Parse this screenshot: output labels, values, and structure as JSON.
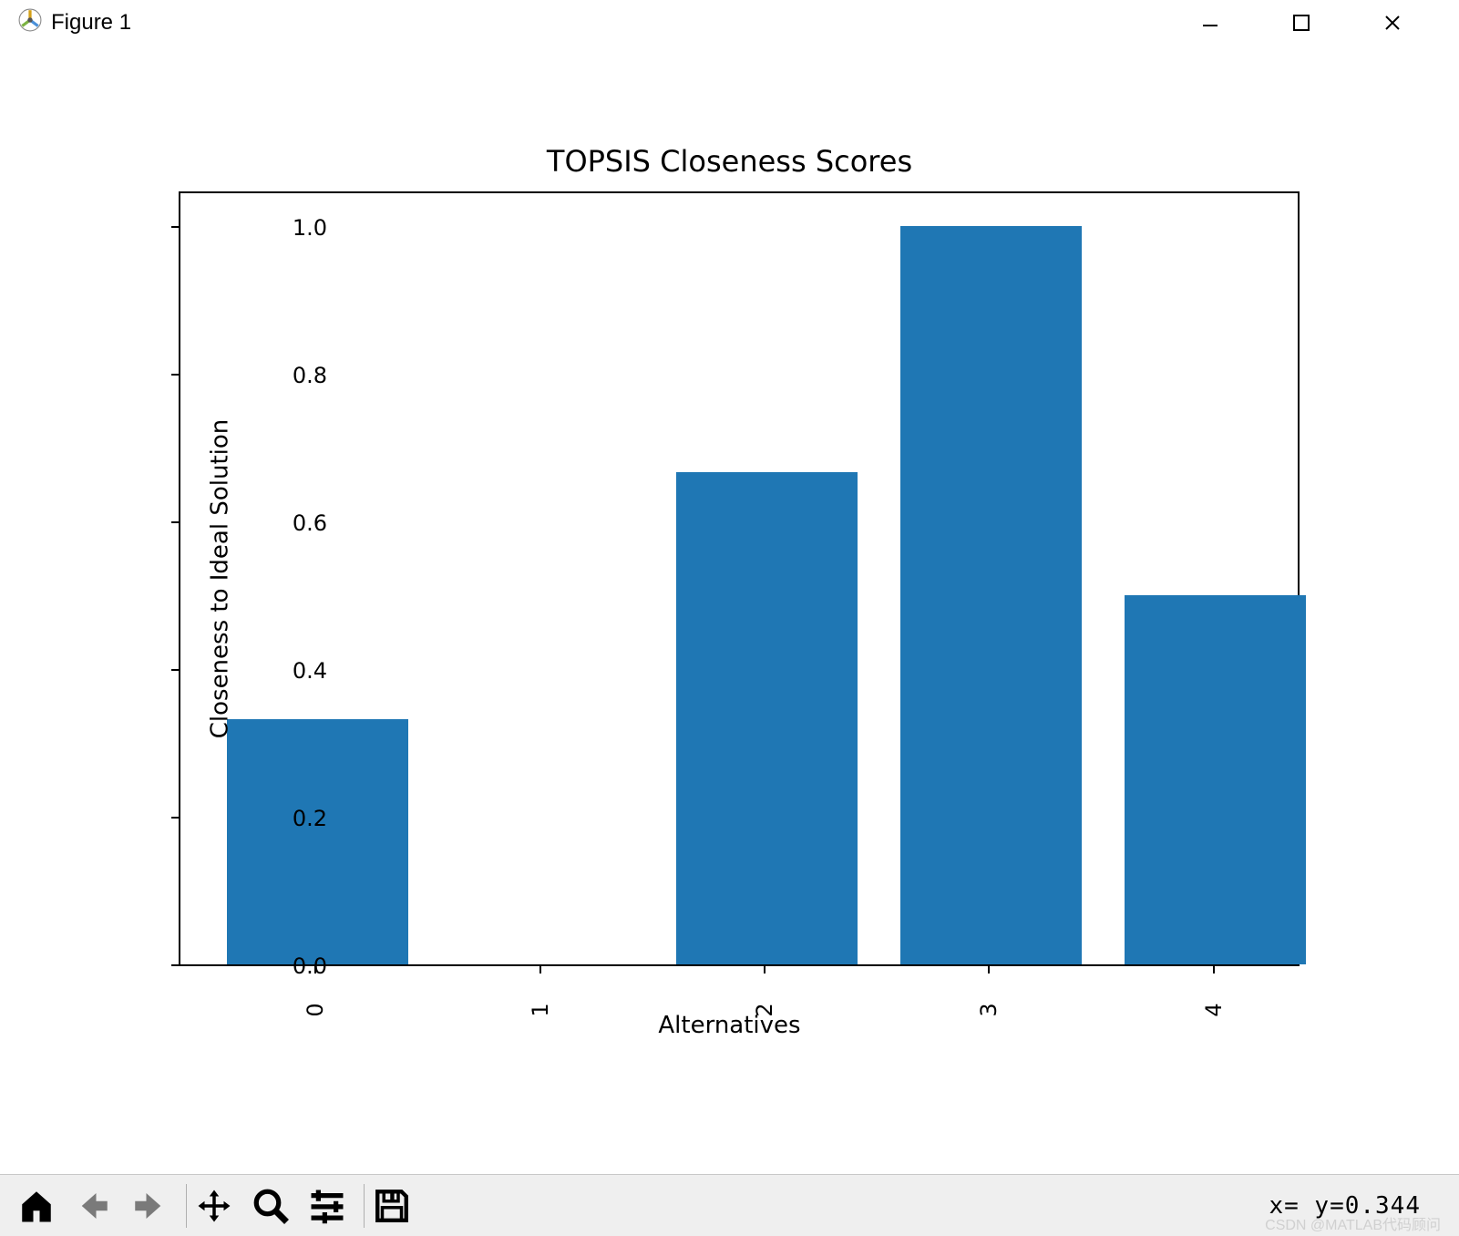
{
  "window": {
    "title": "Figure 1"
  },
  "chart_data": {
    "type": "bar",
    "title": "TOPSIS Closeness Scores",
    "xlabel": "Alternatives",
    "ylabel": "Closeness to Ideal Solution",
    "categories": [
      "0",
      "1",
      "2",
      "3",
      "4"
    ],
    "values": [
      0.333,
      0.0,
      0.667,
      1.0,
      0.5
    ],
    "ylim": [
      0.0,
      1.05
    ],
    "yticks": [
      "0.0",
      "0.2",
      "0.4",
      "0.6",
      "0.8",
      "1.0"
    ]
  },
  "toolbar": {
    "coord_text": "x= y=0.344"
  },
  "watermark": "CSDN @MATLAB代码顾问"
}
